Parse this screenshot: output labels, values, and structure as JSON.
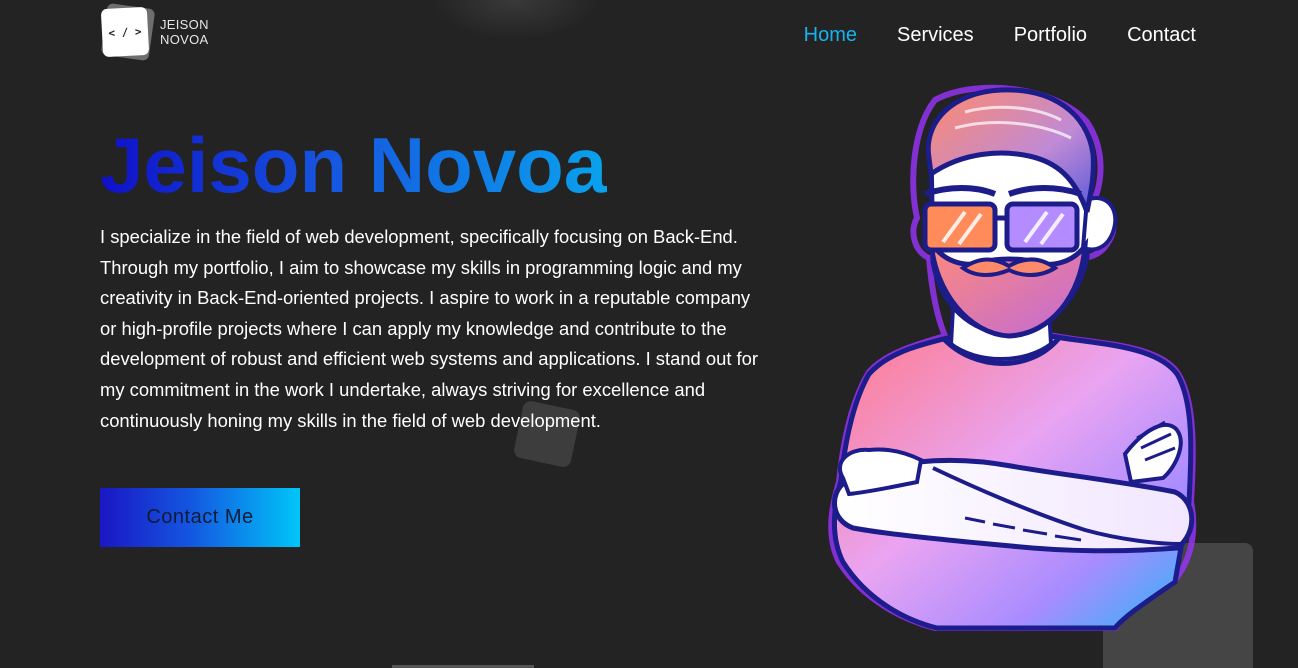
{
  "header": {
    "logo": {
      "mark": "< / >",
      "line1": "JEISON",
      "line2": "NOVOA"
    },
    "nav": [
      {
        "label": "Home",
        "active": true
      },
      {
        "label": "Services",
        "active": false
      },
      {
        "label": "Portfolio",
        "active": false
      },
      {
        "label": "Contact",
        "active": false
      }
    ]
  },
  "hero": {
    "title": "Jeison Novoa",
    "description": "I specialize in the field of web development, specifically focusing on Back-End. Through my portfolio, I aim to showcase my skills in programming logic and my creativity in Back-End-oriented projects. I aspire to work in a reputable company or high-profile projects where I can apply my knowledge and contribute to the development of robust and efficient web systems and applications. I stand out for my commitment in the work I undertake, always striving for excellence and continuously honing my skills in the field of web development.",
    "cta_label": "Contact Me"
  },
  "colors": {
    "background": "#232323",
    "accent": "#19b2f0",
    "gradient_start": "#1010c8",
    "gradient_end": "#0aa2ec"
  },
  "illustration": {
    "icon": "bearded-developer-avatar-illustration"
  }
}
